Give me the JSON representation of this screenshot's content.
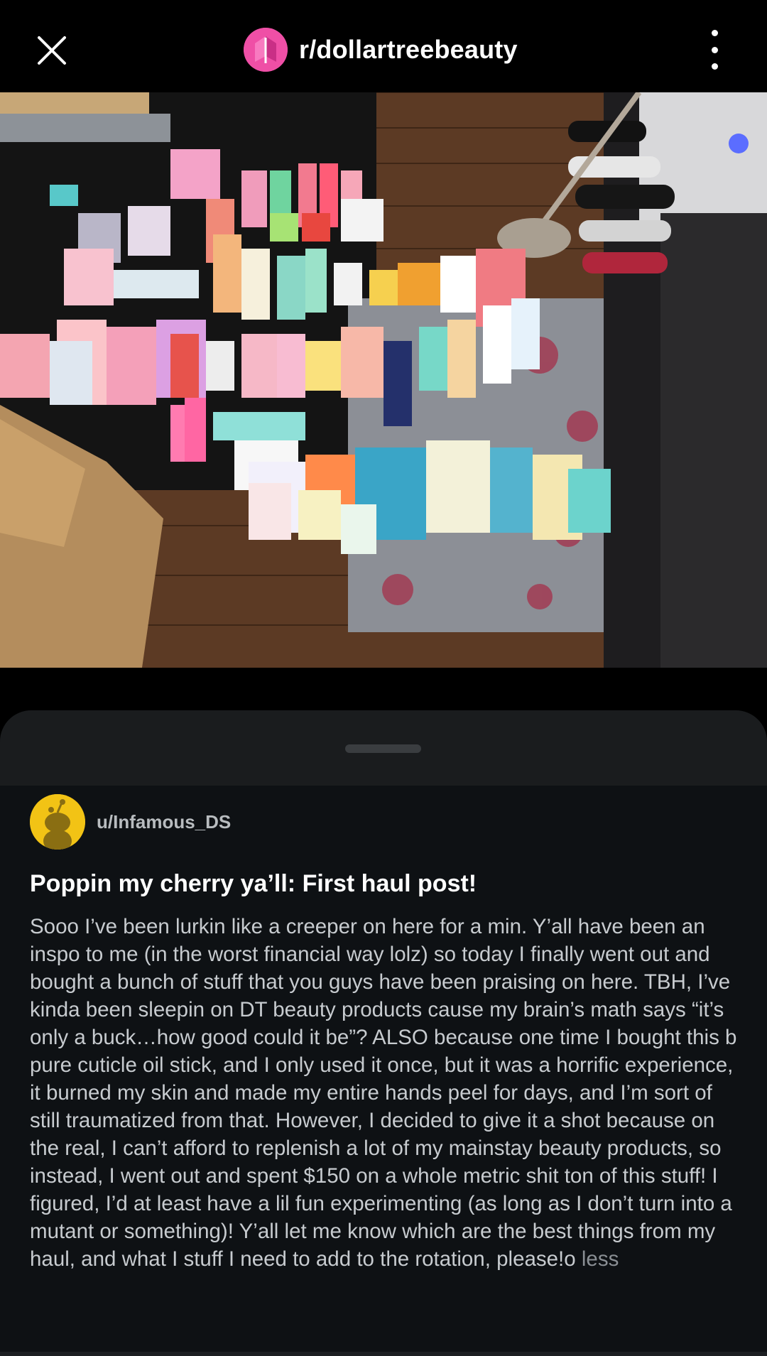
{
  "header": {
    "close_icon": "close-icon",
    "subreddit": "r/dollartreebeauty",
    "subreddit_icon": "subreddit-avatar",
    "more_icon": "more-vertical-icon"
  },
  "media": {
    "kind": "photo",
    "subject": "beauty products haul laid out on floor"
  },
  "post": {
    "author": "u/Infamous_DS",
    "title": "Poppin my cherry ya’ll: First haul post!",
    "body": "Sooo I’ve been lurkin like a creeper on here for a min. Y’all have been an inspo to me (in the worst financial way lolz) so today I finally went out and bought a bunch of stuff that you guys have been praising on here. TBH, I’ve kinda been sleepin on DT beauty products cause my brain’s math says “it’s only a buck…how good could it be”? ALSO because one time I bought this b pure cuticle oil stick, and I only used it once, but it was a horrific experience, it burned my skin and made my entire hands peel for days, and I’m sort of still traumatized from that. However, I decided to give it a shot because on the real, I can’t afford to replenish a lot of my mainstay beauty products, so instead, I went out and spent $150 on a whole metric shit ton of this stuff! I figured, I’d at least have a lil fun experimenting (as long as I don’t turn into a mutant or something)! Y’all let me know which are the best things from my haul, and what I stuff I need to add to the rotation, please!o",
    "show_less": " less"
  },
  "colors": {
    "background": "#000000",
    "sheet": "#0e1114",
    "sheet_header": "#1a1c1e",
    "subreddit_avatar": "#ef4fa6",
    "author_avatar": "#f2c315"
  }
}
